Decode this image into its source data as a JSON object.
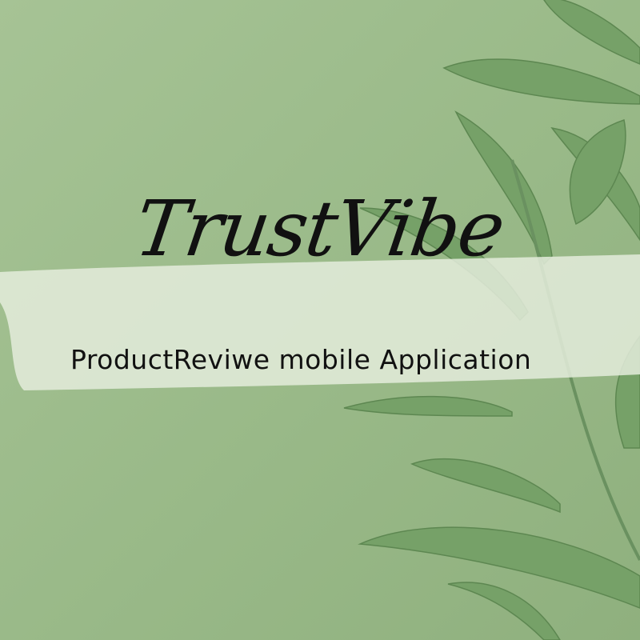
{
  "title": "TrustVibe",
  "subtitle": "ProductReviwe mobile Application",
  "colors": {
    "background": "#9dbc8c",
    "leaf": "#6f9a62",
    "brush": "#e4ecdc",
    "text": "#111111"
  }
}
